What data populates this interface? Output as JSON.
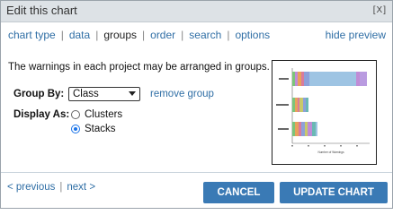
{
  "dialog": {
    "title": "Edit this chart",
    "close_label": "[X]"
  },
  "nav": {
    "items": [
      {
        "label": "chart type"
      },
      {
        "label": "data"
      },
      {
        "label": "groups"
      },
      {
        "label": "order"
      },
      {
        "label": "search"
      },
      {
        "label": "options"
      }
    ],
    "active": "groups",
    "separator": "|",
    "hide_preview": "hide preview"
  },
  "groups": {
    "description": "The warnings in each project may be arranged in groups.",
    "group_by_label": "Group By:",
    "group_by_value": "Class",
    "remove_group": "remove group",
    "display_as_label": "Display As:",
    "display_options": [
      {
        "label": "Clusters",
        "checked": false
      },
      {
        "label": "Stacks",
        "checked": true
      }
    ]
  },
  "preview": {
    "xlabel": "Number of Warnings",
    "colors": [
      "#9ec4e3",
      "#c08cd6",
      "#7cc47a",
      "#e8a15c",
      "#d97b9c",
      "#8ea0d9",
      "#c9c96a",
      "#6ab8b4"
    ]
  },
  "footer": {
    "previous": "< previous",
    "next": "next >",
    "cancel": "CANCEL",
    "update": "UPDATE CHART"
  }
}
